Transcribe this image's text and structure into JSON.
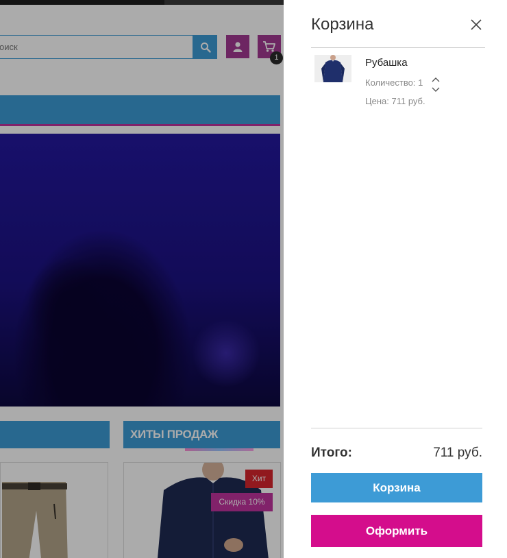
{
  "background_page": {
    "search": {
      "placeholder": "оиск"
    },
    "cart_count": "1",
    "section_hits": "ХИТЫ ПРОДАЖ",
    "badge_hit": "Хит",
    "badge_sale": "Скидка 10%",
    "icons": {
      "search": "search-icon",
      "user": "user-icon",
      "cart": "cart-icon"
    },
    "colors": {
      "primary": "#3d9bd6",
      "accent": "#a33a92",
      "sale": "#c1339f",
      "hit": "#d9262e"
    }
  },
  "cart_panel": {
    "title": "Корзина",
    "close_icon": "close-icon",
    "item": {
      "name": "Рубашка",
      "quantity_label": "Количество:",
      "quantity": "1",
      "price_text": "Цена: 711 руб."
    },
    "total_label": "Итого:",
    "total_value": "711 руб.",
    "cart_button": "Корзина",
    "checkout_button": "Оформить",
    "colors": {
      "cart_button": "#3d9bd6",
      "checkout_button": "#d40d8c"
    }
  }
}
